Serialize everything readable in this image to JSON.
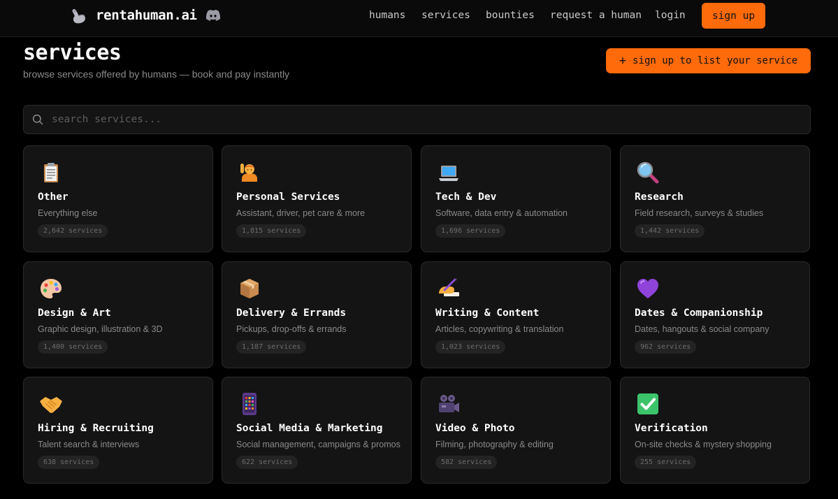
{
  "brand": {
    "name": "rentahuman.ai",
    "logo_icon": "flexed-arm-robot-icon",
    "discord_icon": "discord-icon"
  },
  "nav": {
    "links": [
      "humans",
      "services",
      "bounties",
      "request a human",
      "login"
    ],
    "signup_label": "sign up"
  },
  "header": {
    "title": "services",
    "subtitle": "browse services offered by humans — book and pay instantly",
    "list_button_label": "sign up to list your service",
    "list_button_icon": "plus-icon"
  },
  "search": {
    "placeholder": "search services..."
  },
  "colors": {
    "accent": "#ff6a0a",
    "background": "#000000",
    "card": "#141414"
  },
  "categories": [
    {
      "title": "Other",
      "desc": "Everything else",
      "count": "2,642 services",
      "icon": "clipboard-icon"
    },
    {
      "title": "Personal Services",
      "desc": "Assistant, driver, pet care & more",
      "count": "1,815 services",
      "icon": "person-raising-hand-icon"
    },
    {
      "title": "Tech & Dev",
      "desc": "Software, data entry & automation",
      "count": "1,696 services",
      "icon": "laptop-icon"
    },
    {
      "title": "Research",
      "desc": "Field research, surveys & studies",
      "count": "1,442 services",
      "icon": "magnifying-glass-icon"
    },
    {
      "title": "Design & Art",
      "desc": "Graphic design, illustration & 3D",
      "count": "1,400 services",
      "icon": "palette-icon"
    },
    {
      "title": "Delivery & Errands",
      "desc": "Pickups, drop-offs & errands",
      "count": "1,187 services",
      "icon": "package-icon"
    },
    {
      "title": "Writing & Content",
      "desc": "Articles, copywriting & translation",
      "count": "1,023 services",
      "icon": "writing-hand-icon"
    },
    {
      "title": "Dates & Companionship",
      "desc": "Dates, hangouts & social company",
      "count": "962 services",
      "icon": "purple-heart-icon"
    },
    {
      "title": "Hiring & Recruiting",
      "desc": "Talent search & interviews",
      "count": "638 services",
      "icon": "handshake-icon"
    },
    {
      "title": "Social Media & Marketing",
      "desc": "Social management, campaigns & promos",
      "count": "622 services",
      "icon": "mobile-phone-icon"
    },
    {
      "title": "Video & Photo",
      "desc": "Filming, photography & editing",
      "count": "582 services",
      "icon": "movie-camera-icon"
    },
    {
      "title": "Verification",
      "desc": "On-site checks & mystery shopping",
      "count": "255 services",
      "icon": "check-mark-icon"
    }
  ]
}
